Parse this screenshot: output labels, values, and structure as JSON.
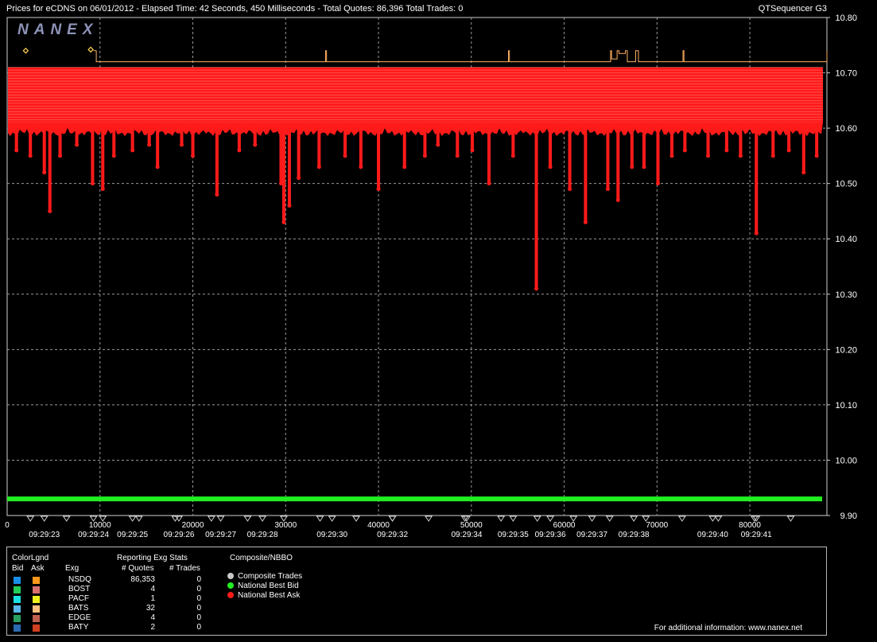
{
  "header": {
    "title": "Prices for  eCDNS  on  06/01/2012  -  Elapsed Time: 42 Seconds, 450 Milliseconds  -  Total Quotes: 86,396  Total Trades: 0",
    "app_name": "QTSequencer G3"
  },
  "logo_text": "NANEX",
  "chart_data": {
    "type": "scatter",
    "title": "Prices for  eCDNS  on  06/01/2012",
    "xlabel": "",
    "ylabel": "",
    "xlim": [
      0,
      88300
    ],
    "ylim": [
      9.9,
      10.8
    ],
    "yticks": [
      "10.80",
      "10.70",
      "10.60",
      "10.50",
      "10.40",
      "10.30",
      "10.20",
      "10.10",
      "10.00",
      "9.90"
    ],
    "xticks": [
      {
        "x": 0,
        "label": "0"
      },
      {
        "x": 10000,
        "label": "10000"
      },
      {
        "x": 20000,
        "label": "20000"
      },
      {
        "x": 30000,
        "label": "30000"
      },
      {
        "x": 40000,
        "label": "40000"
      },
      {
        "x": 50000,
        "label": "50000"
      },
      {
        "x": 60000,
        "label": "60000"
      },
      {
        "x": 70000,
        "label": "70000"
      },
      {
        "x": 80000,
        "label": "80000"
      }
    ],
    "time_labels": [
      {
        "x": 4000,
        "label": "09:29:23"
      },
      {
        "x": 9300,
        "label": "09:29:24"
      },
      {
        "x": 13500,
        "label": "09:29:25"
      },
      {
        "x": 18500,
        "label": "09:29:26"
      },
      {
        "x": 23000,
        "label": "09:29:27"
      },
      {
        "x": 27500,
        "label": "09:29:28"
      },
      {
        "x": 35000,
        "label": "09:29:30"
      },
      {
        "x": 41500,
        "label": "09:29:32"
      },
      {
        "x": 49500,
        "label": "09:29:34"
      },
      {
        "x": 54500,
        "label": "09:29:35"
      },
      {
        "x": 58500,
        "label": "09:29:36"
      },
      {
        "x": 63000,
        "label": "09:29:37"
      },
      {
        "x": 67500,
        "label": "09:29:38"
      },
      {
        "x": 76000,
        "label": "09:29:40"
      },
      {
        "x": 80700,
        "label": "09:29:41"
      }
    ],
    "grid": true,
    "series": [
      {
        "name": "National Best Bid",
        "color": "#22ee22",
        "x": [
          0,
          88300
        ],
        "y": [
          9.93,
          9.93
        ]
      },
      {
        "name": "National Best Ask",
        "color": "#ff1a1a",
        "band": [
          10.61,
          10.71
        ],
        "spikes": [
          {
            "x": 1000,
            "y": 10.56
          },
          {
            "x": 2500,
            "y": 10.55
          },
          {
            "x": 4000,
            "y": 10.52
          },
          {
            "x": 4600,
            "y": 10.45
          },
          {
            "x": 5700,
            "y": 10.55
          },
          {
            "x": 7500,
            "y": 10.57
          },
          {
            "x": 9200,
            "y": 10.5
          },
          {
            "x": 10300,
            "y": 10.49
          },
          {
            "x": 11500,
            "y": 10.55
          },
          {
            "x": 13500,
            "y": 10.56
          },
          {
            "x": 15300,
            "y": 10.57
          },
          {
            "x": 16200,
            "y": 10.53
          },
          {
            "x": 18800,
            "y": 10.57
          },
          {
            "x": 20000,
            "y": 10.55
          },
          {
            "x": 22600,
            "y": 10.48
          },
          {
            "x": 25000,
            "y": 10.56
          },
          {
            "x": 26700,
            "y": 10.57
          },
          {
            "x": 29500,
            "y": 10.5
          },
          {
            "x": 29800,
            "y": 10.43
          },
          {
            "x": 30400,
            "y": 10.46
          },
          {
            "x": 31400,
            "y": 10.51
          },
          {
            "x": 33600,
            "y": 10.53
          },
          {
            "x": 36400,
            "y": 10.55
          },
          {
            "x": 38100,
            "y": 10.53
          },
          {
            "x": 40000,
            "y": 10.49
          },
          {
            "x": 42800,
            "y": 10.53
          },
          {
            "x": 45000,
            "y": 10.55
          },
          {
            "x": 46400,
            "y": 10.57
          },
          {
            "x": 48500,
            "y": 10.55
          },
          {
            "x": 50100,
            "y": 10.56
          },
          {
            "x": 51900,
            "y": 10.5
          },
          {
            "x": 54500,
            "y": 10.55
          },
          {
            "x": 57000,
            "y": 10.31
          },
          {
            "x": 58500,
            "y": 10.53
          },
          {
            "x": 60600,
            "y": 10.49
          },
          {
            "x": 62300,
            "y": 10.43
          },
          {
            "x": 64700,
            "y": 10.49
          },
          {
            "x": 65800,
            "y": 10.47
          },
          {
            "x": 67300,
            "y": 10.53
          },
          {
            "x": 68600,
            "y": 10.53
          },
          {
            "x": 70100,
            "y": 10.5
          },
          {
            "x": 71600,
            "y": 10.55
          },
          {
            "x": 73000,
            "y": 10.56
          },
          {
            "x": 75500,
            "y": 10.55
          },
          {
            "x": 77500,
            "y": 10.56
          },
          {
            "x": 79000,
            "y": 10.55
          },
          {
            "x": 80700,
            "y": 10.41
          },
          {
            "x": 82500,
            "y": 10.55
          },
          {
            "x": 84200,
            "y": 10.56
          },
          {
            "x": 85800,
            "y": 10.52
          },
          {
            "x": 87200,
            "y": 10.55
          }
        ]
      },
      {
        "name": "NSDQ Ask",
        "color": "#ffb060",
        "x": [
          9300,
          9500,
          9600,
          34300,
          34400,
          54000,
          54100,
          65000,
          65100,
          65700,
          65900,
          66600,
          66800,
          67700,
          68000,
          72800,
          72900,
          88300
        ],
        "y": [
          10.74,
          10.74,
          10.72,
          10.74,
          10.72,
          10.74,
          10.72,
          10.74,
          10.725,
          10.74,
          10.735,
          10.74,
          10.72,
          10.74,
          10.72,
          10.74,
          10.72,
          10.74
        ]
      }
    ],
    "markers": [
      {
        "x": 2000,
        "y": 10.74,
        "color": "#ffd24d"
      },
      {
        "x": 9000,
        "y": 10.742,
        "color": "#ffd24d"
      }
    ]
  },
  "legend": {
    "color_legend_title": "ColorLgnd",
    "bid_label": "Bid",
    "ask_label": "Ask",
    "exg_label": "Exg",
    "reporting_title": "Reporting Exg Stats",
    "quotes_label": "# Quotes",
    "trades_label": "# Trades",
    "composite_title": "Composite/NBBO",
    "rows": [
      {
        "exg": "NSDQ",
        "quotes": "86,353",
        "trades": "0",
        "bid_color": "#1a8fe8",
        "ask_color": "#ff9a1a"
      },
      {
        "exg": "BOST",
        "quotes": "4",
        "trades": "0",
        "bid_color": "#22cc55",
        "ask_color": "#d87070"
      },
      {
        "exg": "PACF",
        "quotes": "1",
        "trades": "0",
        "bid_color": "#1ae0e0",
        "ask_color": "#f0f01a"
      },
      {
        "exg": "BATS",
        "quotes": "32",
        "trades": "0",
        "bid_color": "#5ab8e8",
        "ask_color": "#ffc080"
      },
      {
        "exg": "EDGE",
        "quotes": "4",
        "trades": "0",
        "bid_color": "#2aa060",
        "ask_color": "#c06050"
      },
      {
        "exg": "BATY",
        "quotes": "2",
        "trades": "0",
        "bid_color": "#2a6ab0",
        "ask_color": "#d04020"
      }
    ],
    "composite_items": [
      {
        "label": "Composite Trades",
        "color": "#c8c8c8"
      },
      {
        "label": "National Best Bid",
        "color": "#22ee22"
      },
      {
        "label": "National Best Ask",
        "color": "#ff1a1a"
      }
    ],
    "footer": "For additional information: www.nanex.net"
  }
}
